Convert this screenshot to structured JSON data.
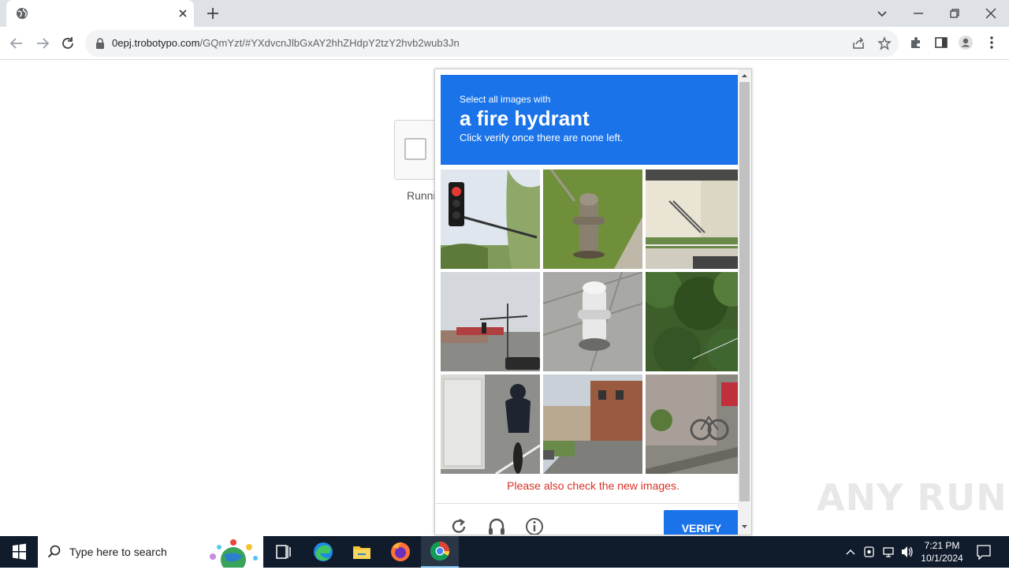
{
  "browser": {
    "url_host": "0epj.trobotypo.com",
    "url_path": "/GQmYzt/#YXdvcnJlbGxAY2hhZHdpY2tzY2hvb2wub3Jn"
  },
  "page": {
    "anchor_text": "Runni"
  },
  "captcha": {
    "prompt_sub": "Select all images with",
    "prompt_main": "a fire hydrant",
    "prompt_hint": "Click verify once there are none left.",
    "error": "Please also check the new images.",
    "verify_label": "VERIFY",
    "tiles": [
      "traffic light",
      "fire hydrant",
      "building with stairs",
      "street with traffic light",
      "fire hydrant",
      "trees",
      "cyclist",
      "street",
      "bicycle"
    ]
  },
  "watermark": "ANY RUN",
  "taskbar": {
    "search_placeholder": "Type here to search",
    "time": "7:21 PM",
    "date": "10/1/2024"
  }
}
